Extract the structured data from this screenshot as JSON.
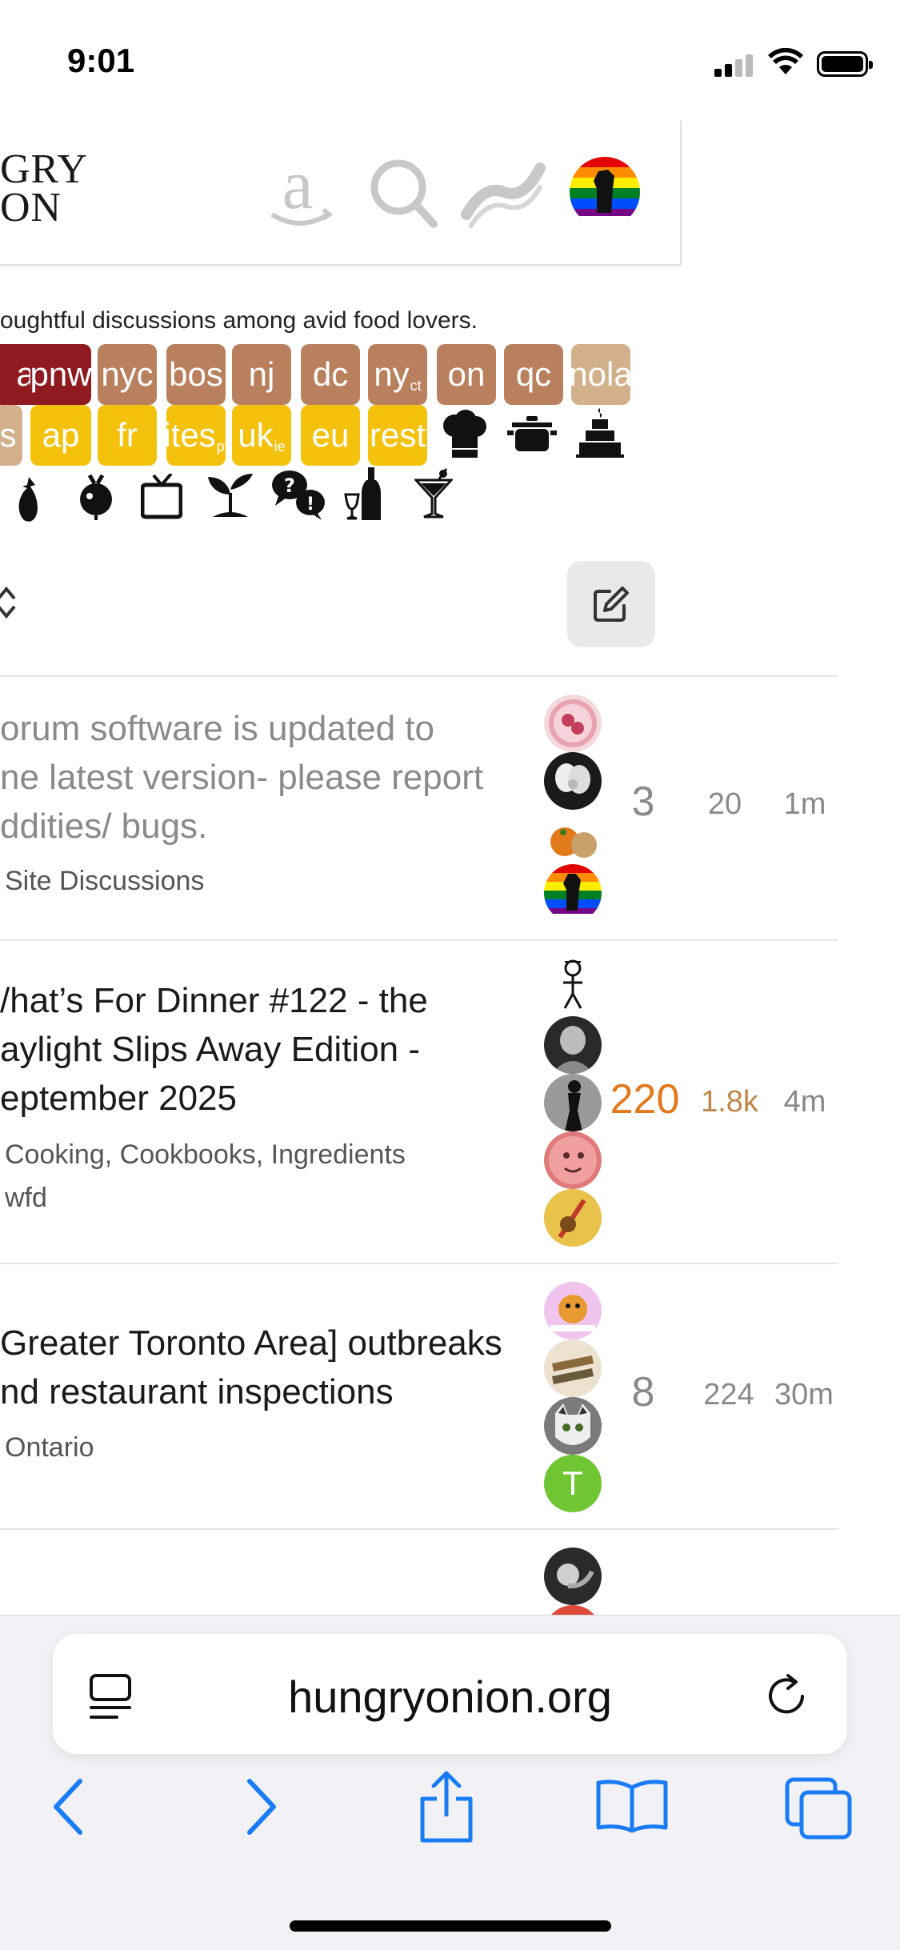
{
  "status_bar": {
    "time": "9:01"
  },
  "header": {
    "logo_line1": "GRY",
    "logo_line2": "ON",
    "icons": [
      "amazon-icon",
      "search-icon",
      "bacon-icon",
      "user-avatar"
    ]
  },
  "tagline": "oughtful discussions among avid food lovers.",
  "region_chips_row1": [
    {
      "label": "a",
      "color": "#8f1a1f"
    },
    {
      "label": "pnw",
      "color": "#8f1a1f"
    },
    {
      "label": "nyc",
      "color": "#b9805e"
    },
    {
      "label": "bos",
      "color": "#b9805e"
    },
    {
      "label": "nj",
      "color": "#b9805e"
    },
    {
      "label": "dc",
      "color": "#b9805e"
    },
    {
      "label": "ny",
      "sub": "ct",
      "color": "#b9805e"
    },
    {
      "label": "on",
      "color": "#b9805e"
    },
    {
      "label": "qc",
      "color": "#b9805e"
    },
    {
      "label": "nola",
      "color": "#d2b08c"
    }
  ],
  "region_chips_row2": [
    {
      "label": "s",
      "color": "#d2b08c"
    },
    {
      "label": "ap",
      "color": "#f4c20d"
    },
    {
      "label": "fr",
      "color": "#f4c20d"
    },
    {
      "label": "ites",
      "sub": "pt",
      "color": "#f4c20d"
    },
    {
      "label": "uk",
      "sub": "ie",
      "color": "#f4c20d"
    },
    {
      "label": "eu",
      "color": "#f4c20d"
    },
    {
      "label": "rest",
      "color": "#f4c20d"
    }
  ],
  "category_icons": [
    "chef-hat-icon",
    "cooking-pot-icon",
    "cake-icon",
    "eggplant-icon",
    "beet-icon",
    "tv-icon",
    "sprout-icon",
    "question-bubble-icon",
    "wine-bottle-icon",
    "cocktail-icon"
  ],
  "topics": [
    {
      "title_lines": [
        "orum software is updated to",
        "ne latest version- please report",
        "ddities/ bugs."
      ],
      "category": "Site Discussions",
      "tags": "",
      "replies": "3",
      "views": "20",
      "activity": "1m",
      "title_color": "#8a8a8a",
      "replies_color": "#8a8a8a",
      "views_color": "#8a8a8a"
    },
    {
      "title_lines": [
        "/hat’s For Dinner #122 - the",
        "aylight Slips Away Edition -",
        "eptember 2025"
      ],
      "category": "Cooking, Cookbooks, Ingredients",
      "tags": "wfd",
      "replies": "220",
      "views": "1.8k",
      "activity": "4m",
      "title_color": "#1a1a1a",
      "replies_color": "#e2781c",
      "views_color": "#c0874a"
    },
    {
      "title_lines": [
        "Greater Toronto Area] outbreaks",
        "nd restaurant inspections"
      ],
      "category": "Ontario",
      "tags": "",
      "replies": "8",
      "views": "224",
      "activity": "30m",
      "title_color": "#1a1a1a",
      "replies_color": "#8a8a8a",
      "views_color": "#8a8a8a"
    }
  ],
  "browser": {
    "url": "hungryonion.org"
  }
}
